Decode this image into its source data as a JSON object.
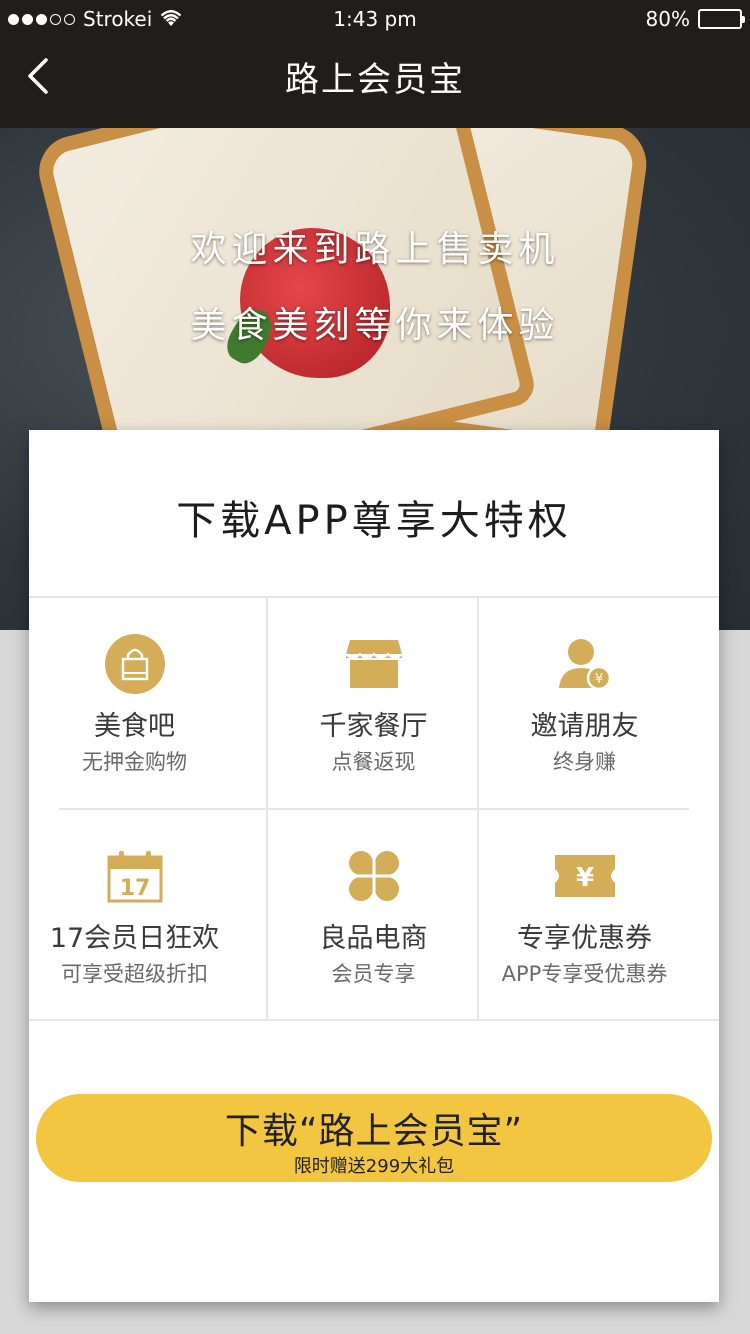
{
  "status_bar": {
    "carrier": "Strokei",
    "time": "1:43 pm",
    "battery_text": "80%",
    "battery_level": 0.8
  },
  "nav": {
    "title": "路上会员宝",
    "back_icon": "chevron-left-icon"
  },
  "hero": {
    "line1": "欢迎来到路上售卖机",
    "line2": "美食美刻等你来体验"
  },
  "card": {
    "title": "下载APP尊享大特权",
    "features": [
      {
        "icon": "shopping-bag-icon",
        "title": "美食吧",
        "subtitle": "无押金购物"
      },
      {
        "icon": "storefront-icon",
        "title": "千家餐厅",
        "subtitle": "点餐返现"
      },
      {
        "icon": "user-yuan-icon",
        "title": "邀请朋友",
        "subtitle": "终身赚"
      },
      {
        "icon": "calendar-17-icon",
        "title": "17会员日狂欢",
        "subtitle": "可享受超级折扣",
        "calendar_day": "17"
      },
      {
        "icon": "clover-icon",
        "title": "良品电商",
        "subtitle": "会员专享"
      },
      {
        "icon": "coupon-yuan-icon",
        "title": "专享优惠券",
        "subtitle": "APP专享受优惠券"
      }
    ],
    "cta": {
      "label": "下载“路上会员宝”",
      "sublabel": "限时赠送299大礼包"
    }
  },
  "colors": {
    "accent_gold": "#d4ad58",
    "cta_yellow": "#f2c640",
    "nav_bg": "#211d1a"
  }
}
